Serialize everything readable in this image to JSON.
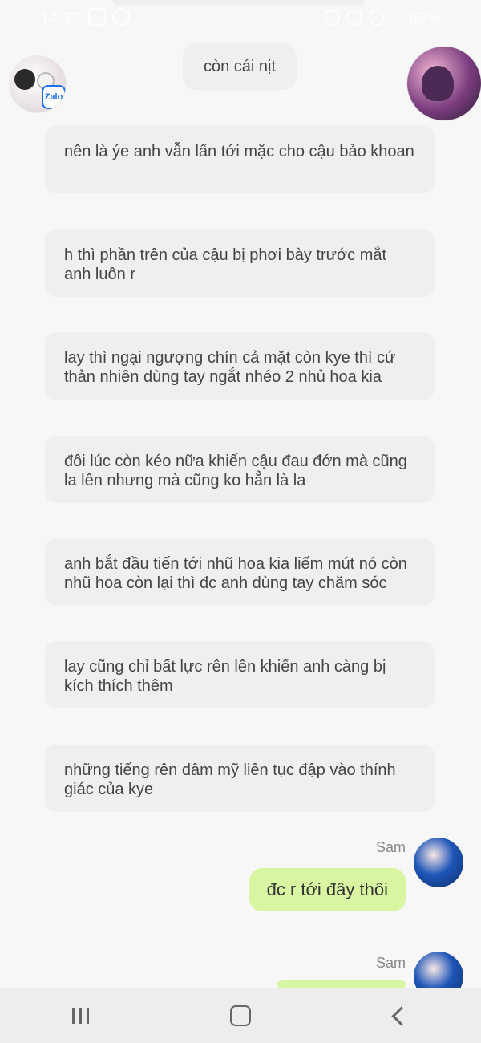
{
  "status": {
    "time": "14:33",
    "battery": "62%"
  },
  "chat": {
    "top_pill": "còn cái nịt",
    "messages": [
      "nên là ýe anh vẫn lấn tới mặc cho cậu bảo khoan",
      "h thì phần trên của cậu bị phơi bày trước mắt anh luôn r",
      "lay thì ngại ngượng chín cả mặt còn kye thì cứ thản nhiên dùng tay ngắt nhéo 2 nhủ hoa kia",
      "đôi lúc còn kéo nữa khiến cậu đau đớn mà cũng la lên nhưng mà cũng ko hẳn là la",
      "anh bắt đầu tiến tới nhũ hoa kia liếm mút nó còn nhũ hoa còn lại thì đc anh dùng tay chăm sóc",
      "lay cũng chỉ bất lực rên lên khiến anh càng bị kích thích thêm",
      "những tiếng rên dâm mỹ liên tục đập vào thính giác của kye"
    ],
    "sam1": {
      "name": "Sam",
      "text": "đc r tới đây thôi"
    },
    "sam2": {
      "name": "Sam"
    }
  },
  "colors": {
    "background": "#f7f7f7",
    "bubble": "#efefef",
    "green_bubble": "#d8f5a2",
    "text": "#444444"
  },
  "icons": {
    "zalo_badge": "Zalo"
  }
}
